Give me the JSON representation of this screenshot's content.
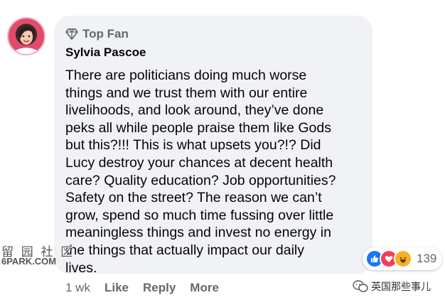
{
  "comment": {
    "badge_label": "Top Fan",
    "author": "Sylvia Pascoe",
    "text": "There are politicians doing much worse\nthings and we trust them with our entire\nlivelihoods, and look around, they’ve done\npeks all while people praise them like Gods\nbut this?!!! This is what upsets you?!? Did\nLucy destroy your chances at decent health\ncare? Quality education? Job opportunities?\nSafety on the street? The reason we can’t\ngrow, spend so much time fussing over little\nmeaningless things and invest no energy in\nthe things that actually impact our daily\nlives.",
    "time": "1 wk",
    "like_label": "Like",
    "reply_label": "Reply",
    "more_label": "More"
  },
  "reactions": {
    "icons": [
      "like-icon",
      "love-icon",
      "haha-icon"
    ],
    "count": "139",
    "colors": {
      "like": "#1877f2",
      "love": "#f33e58",
      "haha": "#f7b125"
    }
  },
  "watermark": {
    "line1": "留 园 社 区",
    "line2": "6PARK.COM"
  },
  "wechat_mark": {
    "text": "英国那些事儿"
  },
  "colors": {
    "bubble": "#f0f2f5",
    "secondary_text": "#65676b",
    "primary_text": "#050505"
  }
}
